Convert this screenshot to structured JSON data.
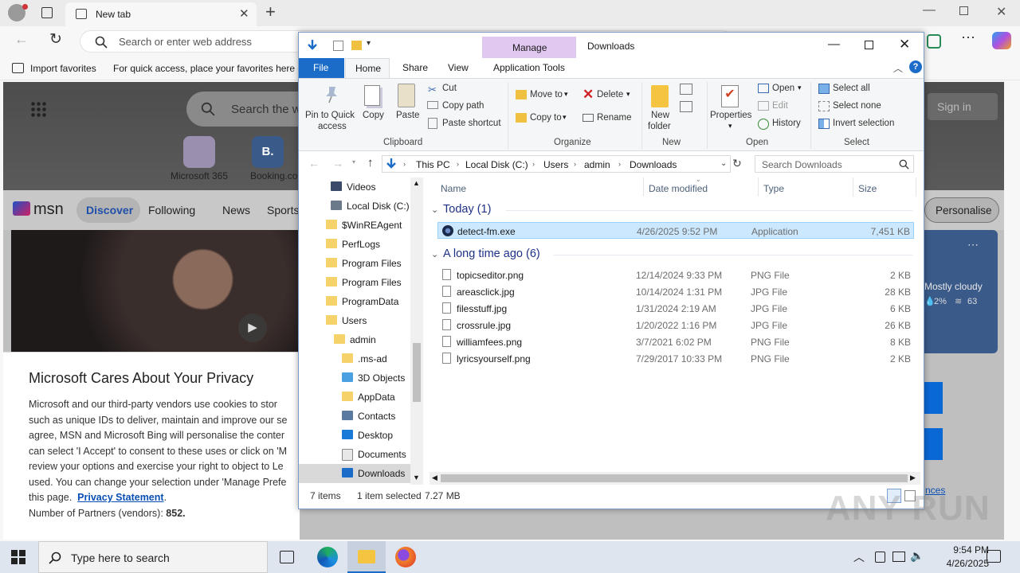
{
  "browser": {
    "tab_title": "New tab",
    "address_placeholder": "Search or enter web address",
    "favbar": {
      "import": "Import favorites",
      "hint": "For quick access, place your favorites here o"
    },
    "page": {
      "search_placeholder": "Search the w",
      "sign_in": "Sign in",
      "shortcuts": [
        "Microsoft 365",
        "Booking.com"
      ],
      "msn_logo": "msn",
      "nav": [
        "Discover",
        "Following",
        "News",
        "Sports"
      ],
      "personalise": "Personalise",
      "weather": {
        "condition": "Mostly cloudy",
        "precip": "2%",
        "humidity": "63"
      },
      "privacy": {
        "title": "Microsoft Cares About Your Privacy",
        "lines": [
          "Microsoft and our third-party vendors use cookies to stor",
          "such as unique IDs to deliver, maintain and improve our se",
          "agree, MSN and Microsoft Bing will personalise the conter",
          "can select 'I Accept' to consent to these uses or click on 'M",
          "review your options and exercise your right to object to Le",
          "used. You can change your selection under 'Manage Prefe"
        ],
        "this_page": "this page.",
        "link": "Privacy Statement",
        "partners_label": "Number of Partners (vendors):",
        "partners_value": "852."
      },
      "side_link": "nces"
    }
  },
  "explorer": {
    "title": "Downloads",
    "manage_label": "Manage",
    "tabs": {
      "file": "File",
      "home": "Home",
      "share": "Share",
      "view": "View",
      "app_tools": "Application Tools"
    },
    "ribbon": {
      "clipboard": {
        "pin": "Pin to Quick",
        "pin2": "access",
        "copy": "Copy",
        "paste": "Paste",
        "cut": "Cut",
        "copy_path": "Copy path",
        "paste_shortcut": "Paste shortcut",
        "group": "Clipboard"
      },
      "organize": {
        "move_to": "Move to",
        "copy_to": "Copy to",
        "delete": "Delete",
        "rename": "Rename",
        "group": "Organize"
      },
      "new": {
        "new_folder": "New",
        "new_folder2": "folder",
        "group": "New"
      },
      "open": {
        "properties": "Properties",
        "open": "Open",
        "edit": "Edit",
        "history": "History",
        "group": "Open"
      },
      "select": {
        "select_all": "Select all",
        "select_none": "Select none",
        "invert": "Invert selection",
        "group": "Select"
      }
    },
    "breadcrumb": [
      "This PC",
      "Local Disk (C:)",
      "Users",
      "admin",
      "Downloads"
    ],
    "search_placeholder": "Search Downloads",
    "nav": [
      {
        "label": "Videos",
        "indent": 0
      },
      {
        "label": "Local Disk (C:)",
        "indent": 0
      },
      {
        "label": "$WinREAgent",
        "indent": 1
      },
      {
        "label": "PerfLogs",
        "indent": 1
      },
      {
        "label": "Program Files",
        "indent": 1
      },
      {
        "label": "Program Files",
        "indent": 1
      },
      {
        "label": "ProgramData",
        "indent": 1
      },
      {
        "label": "Users",
        "indent": 1
      },
      {
        "label": "admin",
        "indent": 2
      },
      {
        "label": ".ms-ad",
        "indent": 3
      },
      {
        "label": "3D Objects",
        "indent": 3
      },
      {
        "label": "AppData",
        "indent": 3
      },
      {
        "label": "Contacts",
        "indent": 3
      },
      {
        "label": "Desktop",
        "indent": 3
      },
      {
        "label": "Documents",
        "indent": 3
      },
      {
        "label": "Downloads",
        "indent": 3
      }
    ],
    "columns": {
      "name": "Name",
      "date": "Date modified",
      "type": "Type",
      "size": "Size"
    },
    "groups": [
      {
        "label": "Today (1)",
        "files": [
          {
            "name": "detect-fm.exe",
            "date": "4/26/2025 9:52 PM",
            "type": "Application",
            "size": "7,451 KB",
            "selected": true
          }
        ]
      },
      {
        "label": "A long time ago (6)",
        "files": [
          {
            "name": "topicseditor.png",
            "date": "12/14/2024 9:33 PM",
            "type": "PNG File",
            "size": "2 KB"
          },
          {
            "name": "areasclick.jpg",
            "date": "10/14/2024 1:31 PM",
            "type": "JPG File",
            "size": "28 KB"
          },
          {
            "name": "filesstuff.jpg",
            "date": "1/31/2024 2:19 AM",
            "type": "JPG File",
            "size": "6 KB"
          },
          {
            "name": "crossrule.jpg",
            "date": "1/20/2022 1:16 PM",
            "type": "JPG File",
            "size": "26 KB"
          },
          {
            "name": "williamfees.png",
            "date": "3/7/2021 6:02 PM",
            "type": "PNG File",
            "size": "8 KB"
          },
          {
            "name": "lyricsyourself.png",
            "date": "7/29/2017 10:33 PM",
            "type": "PNG File",
            "size": "2 KB"
          }
        ]
      }
    ],
    "status": {
      "items": "7 items",
      "selected": "1 item selected",
      "size": "7.27 MB"
    }
  },
  "taskbar": {
    "search_placeholder": "Type here to search",
    "time": "9:54 PM",
    "date": "4/26/2025"
  },
  "watermark": "ANY RUN"
}
